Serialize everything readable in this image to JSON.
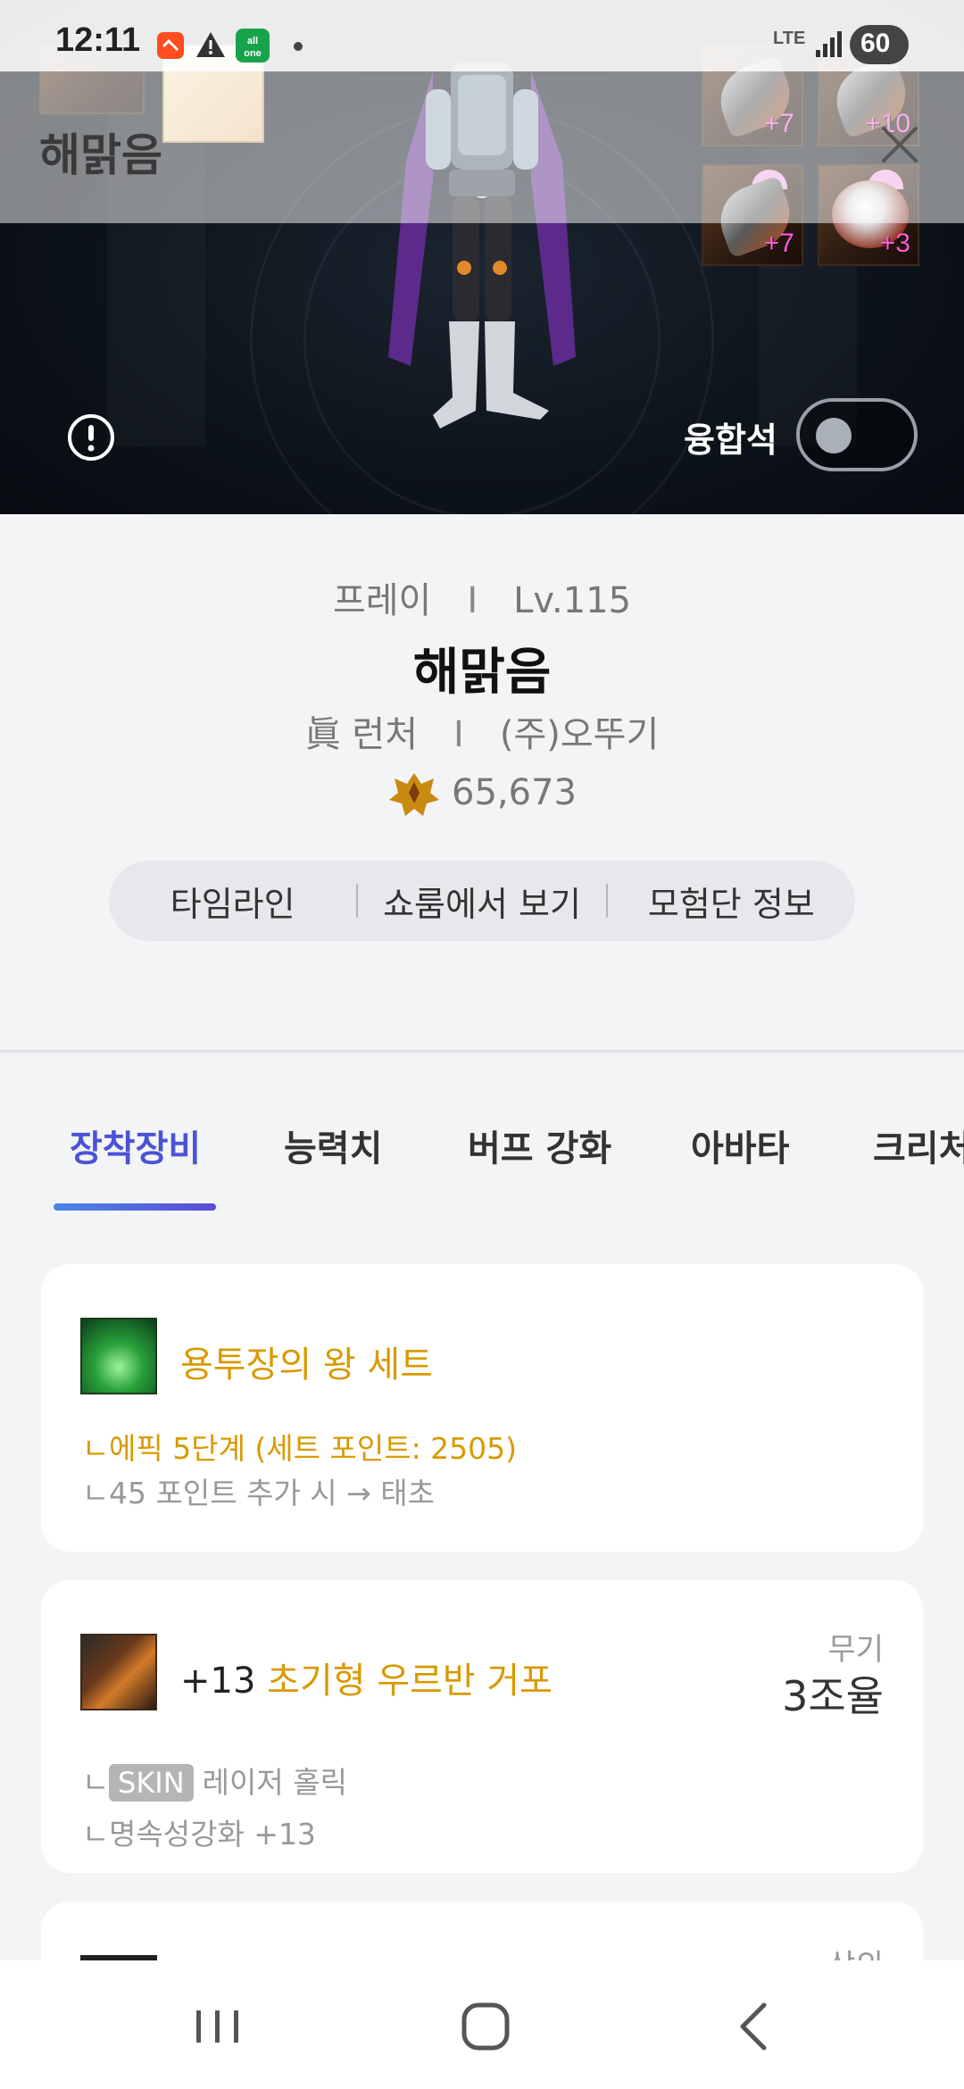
{
  "status_bar": {
    "time": "12:11",
    "network": "LTE",
    "battery": "60"
  },
  "hero": {
    "overlay_name": "해맑음",
    "fusion_label": "융합석",
    "equip_slots": [
      "+7",
      "+10",
      "+7",
      "+3"
    ]
  },
  "profile": {
    "job": "프레이",
    "separator": "I",
    "level": "Lv.115",
    "name": "해맑음",
    "title": "眞 런처",
    "guild": "(주)오뚜기",
    "fame": "65,673",
    "links": [
      "타임라인",
      "쇼룸에서 보기",
      "모험단 정보"
    ]
  },
  "tabs": [
    "장착장비",
    "능력치",
    "버프 강화",
    "아바타",
    "크리처"
  ],
  "active_tab": 0,
  "set_card": {
    "name": "용투장의 왕 세트",
    "tier": "에픽 5단계 (세트 포인트: 2505)",
    "next": "45 포인트 추가 시 → 태초",
    "hook": "ㄴ"
  },
  "weapon_card": {
    "reinforce": "+13",
    "name": "초기형 우르반 거포",
    "type": "무기",
    "rate": "3조율",
    "skin_badge": "SKIN",
    "skin_name": "레이저 홀릭",
    "enchant": "명속성강화 +13"
  },
  "peek_card": {
    "type": "상의"
  },
  "icons": {
    "info": "info-circle-icon",
    "close": "close-icon",
    "fame": "fame-crest-icon",
    "nav_recents": "recents-icon",
    "nav_home": "home-icon",
    "nav_back": "back-icon"
  },
  "colors": {
    "accent": "#4a53d6",
    "gold": "#d89a00",
    "reinforce_pink": "#ff5ad8"
  }
}
